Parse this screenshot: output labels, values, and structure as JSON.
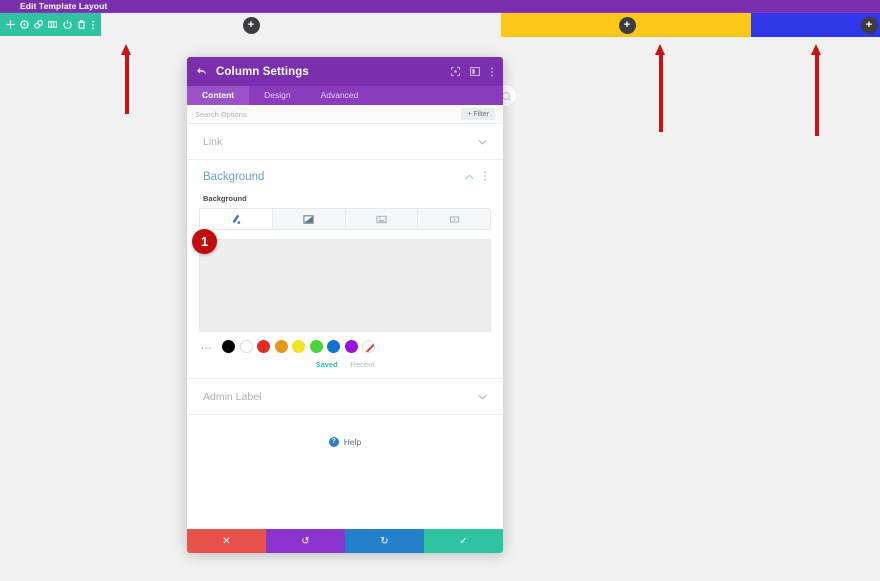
{
  "admin_bar": {
    "title": "Edit Template Layout",
    "bg": "#7a2fad"
  },
  "builder_row": {
    "columns": [
      {
        "name": "column-gray",
        "color": "#f0f0f0",
        "add_label": "+"
      },
      {
        "name": "column-yellow",
        "color": "#fdc717",
        "add_label": "+"
      },
      {
        "name": "column-blue",
        "color": "#2f37e8",
        "add_label": "+"
      }
    ]
  },
  "module_toolbar": {
    "icons": [
      "move-icon",
      "gear-icon",
      "duplicate-icon",
      "columns-icon",
      "power-icon",
      "trash-icon",
      "more-vertical-icon"
    ]
  },
  "modal": {
    "back_icon": "back-arrow-icon",
    "title": "Column Settings",
    "header_icons": [
      "expand-icon",
      "dock-panel-icon",
      "more-vertical-icon"
    ],
    "tabs": [
      {
        "label": "Content",
        "active": true
      },
      {
        "label": "Design",
        "active": false
      },
      {
        "label": "Advanced",
        "active": false
      }
    ],
    "search": {
      "placeholder": "Search Options",
      "filter_label": "Filter"
    },
    "link_section": {
      "label": "Link",
      "chevron": "chevron-down-icon"
    },
    "background_section": {
      "title": "Background",
      "collapse_icon": "chevron-up-icon",
      "more_icon": "more-vertical-icon",
      "field_label": "Background",
      "type_tabs": [
        {
          "name": "background-color-tab",
          "icon": "paint-drop-icon",
          "active": true
        },
        {
          "name": "background-gradient-tab",
          "icon": "gradient-icon",
          "active": false
        },
        {
          "name": "background-image-tab",
          "icon": "image-icon",
          "active": false
        },
        {
          "name": "background-video-tab",
          "icon": "video-icon",
          "active": false
        }
      ],
      "swatches": [
        {
          "name": "swatch-black",
          "color": "#000000"
        },
        {
          "name": "swatch-white",
          "color": "#ffffff"
        },
        {
          "name": "swatch-red",
          "color": "#e02b20"
        },
        {
          "name": "swatch-orange",
          "color": "#e8971a"
        },
        {
          "name": "swatch-yellow",
          "color": "#f2e322"
        },
        {
          "name": "swatch-green",
          "color": "#4bd43b"
        },
        {
          "name": "swatch-blue",
          "color": "#1273d1"
        },
        {
          "name": "swatch-purple",
          "color": "#9512e0"
        },
        {
          "name": "swatch-transparent",
          "color": "transparent"
        }
      ],
      "more_colors_label": "...",
      "palette_tabs": [
        {
          "label": "Saved",
          "active": true
        },
        {
          "label": "Recent",
          "active": false
        }
      ]
    },
    "admin_label_section": {
      "label": "Admin Label",
      "chevron": "chevron-down-icon"
    },
    "help": {
      "icon": "question-mark-icon",
      "label": "Help"
    },
    "footer_buttons": [
      {
        "name": "cancel-button",
        "icon": "✕",
        "color": "#e8514a"
      },
      {
        "name": "undo-button",
        "icon": "↺",
        "color": "#8b34cf"
      },
      {
        "name": "redo-button",
        "icon": "↻",
        "color": "#2380c9"
      },
      {
        "name": "save-button",
        "icon": "✓",
        "color": "#2ec4a0"
      }
    ]
  },
  "annotations": {
    "step_badge": "1",
    "arrow_color": "#cc1111",
    "arrow_count": 3
  }
}
